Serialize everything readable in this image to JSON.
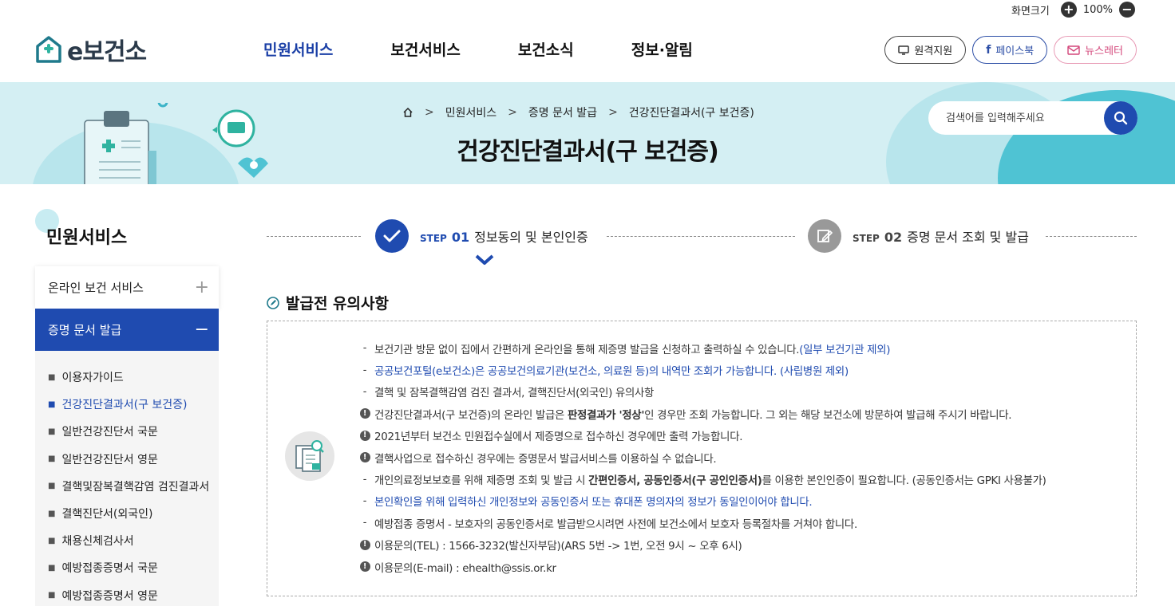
{
  "zoom": {
    "label": "화면크기",
    "value": "100%",
    "plus": "+",
    "minus": "−"
  },
  "logo": {
    "text": "e보건소"
  },
  "gnb": [
    {
      "label": "민원서비스",
      "active": true
    },
    {
      "label": "보건서비스",
      "active": false
    },
    {
      "label": "보건소식",
      "active": false
    },
    {
      "label": "정보·알림",
      "active": false
    }
  ],
  "header_buttons": {
    "remote": "원격지원",
    "facebook": "페이스북",
    "newsletter": "뉴스레터"
  },
  "breadcrumb": {
    "level1": "민원서비스",
    "level2": "증명 문서 발급",
    "level3": "건강진단결과서(구 보건증)"
  },
  "page_title": "건강진단결과서(구 보건증)",
  "search": {
    "placeholder": "검색어를 입력해주세요"
  },
  "sidebar": {
    "title": "민원서비스",
    "menus": [
      {
        "label": "온라인 보건 서비스",
        "toggle": "+"
      },
      {
        "label": "증명 문서 발급",
        "toggle": "−"
      }
    ],
    "sub_items": [
      "이용자가이드",
      "건강진단결과서(구 보건증)",
      "일반건강진단서 국문",
      "일반건강진단서 영문",
      "결핵및잠복결핵감염 검진결과서",
      "결핵진단서(외국인)",
      "채용신체검사서",
      "예방접종증명서 국문",
      "예방접종증명서 영문"
    ]
  },
  "steps": {
    "step1": {
      "prefix": "STEP",
      "num": "01",
      "label": "정보동의 및 본인인증"
    },
    "step2": {
      "prefix": "STEP",
      "num": "02",
      "label": "증명 문서 조회 및 발급"
    }
  },
  "notice": {
    "title": "발급전 유의사항",
    "lines": {
      "l1a": "보건기관 방문 없이 집에서 간편하게 온라인을 통해 제증명 발급을 신청하고 출력하실 수 있습니다.",
      "l1b": "(일부 보건기관 제외)",
      "l2": "공공보건포털(e보건소)은 공공보건의료기관(보건소, 의료원 등)의 내역만 조회가 가능합니다. (사립병원 제외)",
      "l3": "결핵 및 잠복결핵감염 검진 결과서, 결핵진단서(외국인) 유의사항",
      "l4a": "건강진단결과서(구 보건증)의 온라인 발급은 ",
      "l4b": "판정결과가 '정상'",
      "l4c": "인 경우만 조회 가능합니다. 그 외는 해당 보건소에 방문하여 발급해 주시기 바랍니다.",
      "l5": "2021년부터 보건소 민원접수실에서 제증명으로 접수하신 경우에만 출력 가능합니다.",
      "l6": "결핵사업으로 접수하신 경우에는 증명문서 발급서비스를 이용하실 수 없습니다.",
      "l7a": "개인의료정보보호를 위해 제증명 조회 및 발급 시 ",
      "l7b": "간편인증서, 공동인증서(구 공인인증서)",
      "l7c": "를 이용한 본인인증이 필요합니다. (공동인증서는 GPKI 사용불가)",
      "l8": "본인확인을 위해 입력하신 개인정보와 공동인증서 또는 휴대폰 명의자의 정보가 동일인이어야 합니다.",
      "l9": "예방접종 증명서 - 보호자의 공동인증서로 발급받으시려면 사전에 보건소에서 보호자 등록절차를 거쳐야 합니다.",
      "l10": "이용문의(TEL) : 1566-3232(발신자부담)(ARS 5번 -> 1번, 오전 9시 ~ 오후 6시)",
      "l11": "이용문의(E-mail) : ehealth@ssis.or.kr"
    }
  },
  "colors": {
    "brand": "#1f4bb0",
    "banner_bg": "#d4eff3",
    "accent": "#4fc3d3"
  }
}
